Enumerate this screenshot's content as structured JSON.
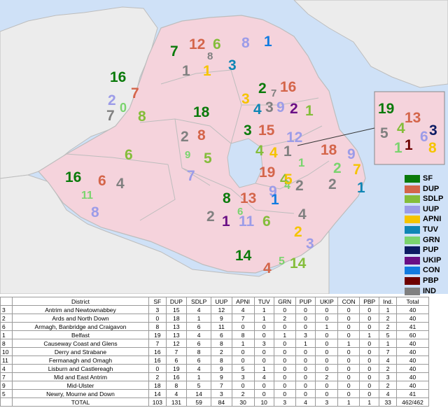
{
  "colors": {
    "sea": "#cfe1f7",
    "land": "#ececec",
    "ni": "#f5d3dc",
    "border": "#bdbdbd",
    "SF": "#0a7a0a",
    "DUP": "#d4654a",
    "SDLP": "#84bd3a",
    "UUP": "#9c9ce8",
    "APNI": "#f5c400",
    "TUV": "#0f86b5",
    "GRN": "#7ad46e",
    "PUP": "#0d1b63",
    "UKIP": "#6a0f85",
    "CON": "#127be0",
    "PBP": "#6e0000",
    "IND": "#808080"
  },
  "legend": [
    {
      "party": "SF",
      "label": "SF"
    },
    {
      "party": "DUP",
      "label": "DUP"
    },
    {
      "party": "SDLP",
      "label": "SDLP"
    },
    {
      "party": "UUP",
      "label": "UUP"
    },
    {
      "party": "APNI",
      "label": "APNI"
    },
    {
      "party": "TUV",
      "label": "TUV"
    },
    {
      "party": "GRN",
      "label": "GRN"
    },
    {
      "party": "PUP",
      "label": "PUP"
    },
    {
      "party": "UKIP",
      "label": "UKIP"
    },
    {
      "party": "CON",
      "label": "CON"
    },
    {
      "party": "PBP",
      "label": "PBP"
    },
    {
      "party": "IND",
      "label": "IND"
    }
  ],
  "map_labels": [
    {
      "text": "16",
      "party": "SF"
    },
    {
      "text": "7",
      "party": "DUP"
    },
    {
      "text": "2",
      "party": "UUP"
    },
    {
      "text": "7",
      "party": "IND"
    },
    {
      "text": "0",
      "party": "GRN"
    },
    {
      "text": "8",
      "party": "SDLP"
    },
    {
      "text": "7",
      "party": "SF"
    },
    {
      "text": "12",
      "party": "DUP"
    },
    {
      "text": "8",
      "party": "IND"
    },
    {
      "text": "6",
      "party": "SDLP"
    },
    {
      "text": "8",
      "party": "UUP"
    },
    {
      "text": "1",
      "party": "CON"
    },
    {
      "text": "1",
      "party": "IND"
    },
    {
      "text": "1",
      "party": "APNI"
    },
    {
      "text": "3",
      "party": "TUV"
    },
    {
      "text": "18",
      "party": "SF"
    },
    {
      "text": "2",
      "party": "IND"
    },
    {
      "text": "8",
      "party": "DUP"
    },
    {
      "text": "9",
      "party": "GRN"
    },
    {
      "text": "5",
      "party": "SDLP"
    },
    {
      "text": "7",
      "party": "UUP"
    },
    {
      "text": "6",
      "party": "SDLP"
    },
    {
      "text": "16",
      "party": "SF"
    },
    {
      "text": "6",
      "party": "DUP"
    },
    {
      "text": "11",
      "party": "GRN"
    },
    {
      "text": "4",
      "party": "IND"
    },
    {
      "text": "8",
      "party": "UUP"
    },
    {
      "text": "3",
      "party": "APNI"
    },
    {
      "text": "2",
      "party": "SF"
    },
    {
      "text": "7",
      "party": "IND"
    },
    {
      "text": "16",
      "party": "DUP"
    },
    {
      "text": "4",
      "party": "TUV"
    },
    {
      "text": "3",
      "party": "IND"
    },
    {
      "text": "9",
      "party": "UUP"
    },
    {
      "text": "2",
      "party": "UKIP"
    },
    {
      "text": "1",
      "party": "SDLP"
    },
    {
      "text": "3",
      "party": "SF"
    },
    {
      "text": "15",
      "party": "DUP"
    },
    {
      "text": "12",
      "party": "UUP"
    },
    {
      "text": "4",
      "party": "SDLP"
    },
    {
      "text": "4",
      "party": "APNI"
    },
    {
      "text": "1",
      "party": "IND"
    },
    {
      "text": "1",
      "party": "GRN"
    },
    {
      "text": "18",
      "party": "DUP"
    },
    {
      "text": "9",
      "party": "UUP"
    },
    {
      "text": "2",
      "party": "GRN"
    },
    {
      "text": "7",
      "party": "APNI"
    },
    {
      "text": "2",
      "party": "IND"
    },
    {
      "text": "1",
      "party": "TUV"
    },
    {
      "text": "19",
      "party": "DUP"
    },
    {
      "text": "4",
      "party": "SDLP"
    },
    {
      "text": "9",
      "party": "UUP"
    },
    {
      "text": "4",
      "party": "GRN"
    },
    {
      "text": "2",
      "party": "IND"
    },
    {
      "text": "5",
      "party": "APNI"
    },
    {
      "text": "1",
      "party": "CON"
    },
    {
      "text": "8",
      "party": "SF"
    },
    {
      "text": "13",
      "party": "DUP"
    },
    {
      "text": "2",
      "party": "IND"
    },
    {
      "text": "6",
      "party": "GRN"
    },
    {
      "text": "1",
      "party": "UKIP"
    },
    {
      "text": "11",
      "party": "UUP"
    },
    {
      "text": "6",
      "party": "SDLP"
    },
    {
      "text": "4",
      "party": "IND"
    },
    {
      "text": "2",
      "party": "APNI"
    },
    {
      "text": "3",
      "party": "UUP"
    },
    {
      "text": "14",
      "party": "SF"
    },
    {
      "text": "4",
      "party": "DUP"
    },
    {
      "text": "5",
      "party": "GRN"
    },
    {
      "text": "14",
      "party": "SDLP"
    },
    {
      "text": "19",
      "party": "SF"
    },
    {
      "text": "13",
      "party": "DUP"
    },
    {
      "text": "4",
      "party": "SDLP"
    },
    {
      "text": "5",
      "party": "IND"
    },
    {
      "text": "1",
      "party": "GRN"
    },
    {
      "text": "1",
      "party": "PBP"
    },
    {
      "text": "6",
      "party": "UUP"
    },
    {
      "text": "3",
      "party": "PUP"
    },
    {
      "text": "8",
      "party": "APNI"
    }
  ],
  "table": {
    "headers": [
      "",
      "District",
      "SF",
      "DUP",
      "SDLP",
      "UUP",
      "APNI",
      "TUV",
      "GRN",
      "PUP",
      "UKIP",
      "CON",
      "PBP",
      "Ind.",
      "Total"
    ],
    "rows": [
      [
        "3",
        "Antrim and Newtownabbey",
        "3",
        "15",
        "4",
        "12",
        "4",
        "1",
        "0",
        "0",
        "0",
        "0",
        "0",
        "1",
        "40"
      ],
      [
        "2",
        "Ards and North Down",
        "0",
        "18",
        "1",
        "9",
        "7",
        "1",
        "2",
        "0",
        "0",
        "0",
        "0",
        "2",
        "40"
      ],
      [
        "6",
        "Armagh, Banbridge and Craigavon",
        "8",
        "13",
        "6",
        "11",
        "0",
        "0",
        "0",
        "0",
        "1",
        "0",
        "0",
        "2",
        "41"
      ],
      [
        "1",
        "Belfast",
        "19",
        "13",
        "4",
        "6",
        "8",
        "0",
        "1",
        "3",
        "0",
        "0",
        "1",
        "5",
        "60"
      ],
      [
        "8",
        "Causeway Coast and Glens",
        "7",
        "12",
        "6",
        "8",
        "1",
        "3",
        "0",
        "1",
        "0",
        "1",
        "0",
        "1",
        "40"
      ],
      [
        "10",
        "Derry and Strabane",
        "16",
        "7",
        "8",
        "2",
        "0",
        "0",
        "0",
        "0",
        "0",
        "0",
        "0",
        "7",
        "40"
      ],
      [
        "11",
        "Fermanagh and Omagh",
        "16",
        "6",
        "6",
        "8",
        "0",
        "0",
        "0",
        "0",
        "0",
        "0",
        "0",
        "4",
        "40"
      ],
      [
        "4",
        "Lisburn and Castlereagh",
        "0",
        "19",
        "4",
        "9",
        "5",
        "1",
        "0",
        "0",
        "0",
        "0",
        "0",
        "2",
        "40"
      ],
      [
        "7",
        "Mid and East Antrim",
        "2",
        "16",
        "1",
        "9",
        "3",
        "4",
        "0",
        "0",
        "2",
        "0",
        "0",
        "3",
        "40"
      ],
      [
        "9",
        "Mid-Ulster",
        "18",
        "8",
        "5",
        "7",
        "0",
        "0",
        "0",
        "0",
        "0",
        "0",
        "0",
        "2",
        "40"
      ],
      [
        "5",
        "Newry, Mourne and Down",
        "14",
        "4",
        "14",
        "3",
        "2",
        "0",
        "0",
        "0",
        "0",
        "0",
        "0",
        "4",
        "41"
      ],
      [
        "",
        "TOTAL",
        "103",
        "131",
        "59",
        "84",
        "30",
        "10",
        "3",
        "4",
        "3",
        "1",
        "1",
        "33",
        "462/462"
      ]
    ]
  }
}
